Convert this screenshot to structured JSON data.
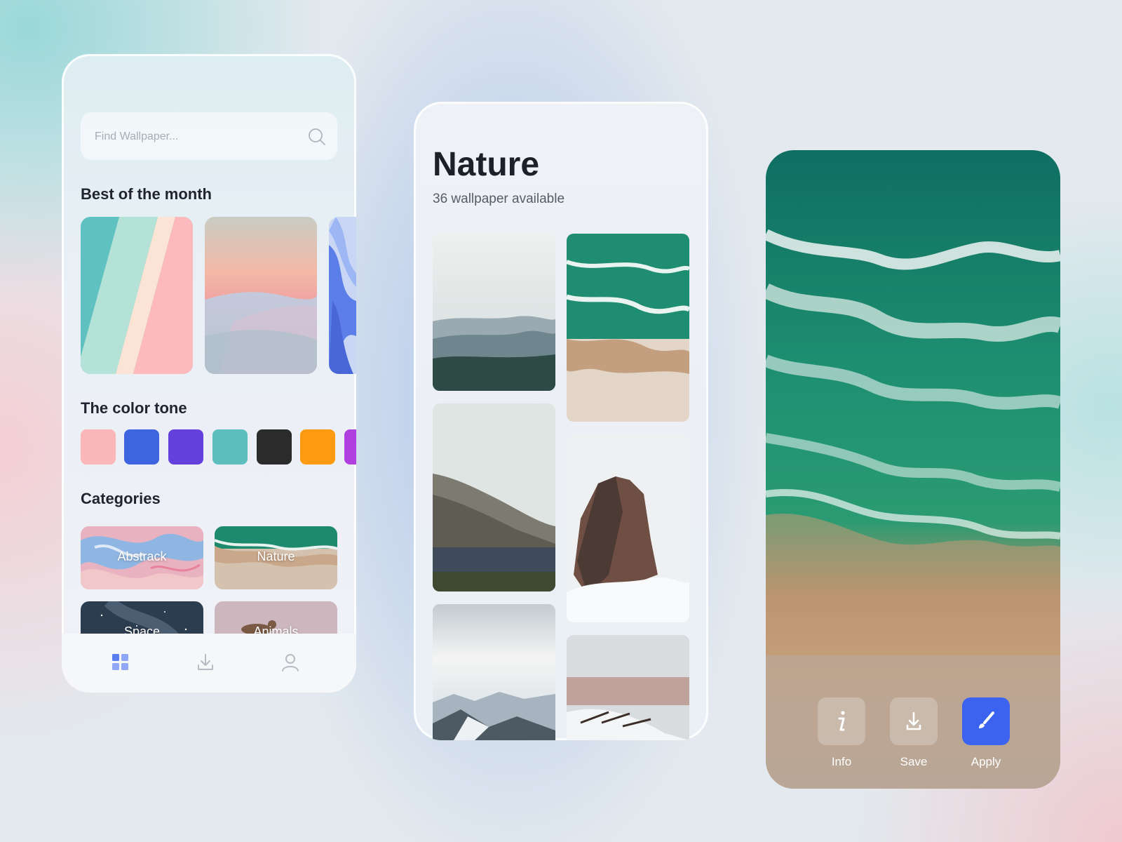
{
  "screen1": {
    "search": {
      "placeholder": "Find Wallpaper..."
    },
    "best_of_month": {
      "title": "Best of the month"
    },
    "color_tone": {
      "title": "The color tone",
      "colors": [
        "#fbb6b9",
        "#3e64e0",
        "#6440dd",
        "#5cbfbe",
        "#2b2b2b",
        "#fe9a0f",
        "#b03fe0"
      ]
    },
    "categories": {
      "title": "Categories",
      "items": [
        {
          "label": "Abstrack"
        },
        {
          "label": "Nature"
        },
        {
          "label": "Space"
        },
        {
          "label": "Animals"
        }
      ]
    },
    "nav": {
      "active_color": "#6c8cf5",
      "inactive_color": "#b7bcc4"
    }
  },
  "screen2": {
    "title": "Nature",
    "subtitle": "36 wallpaper available"
  },
  "screen3": {
    "actions": [
      {
        "label": "Info",
        "icon": "info-icon"
      },
      {
        "label": "Save",
        "icon": "download-icon"
      },
      {
        "label": "Apply",
        "icon": "brush-icon"
      }
    ],
    "accent": "#3c63f0"
  }
}
